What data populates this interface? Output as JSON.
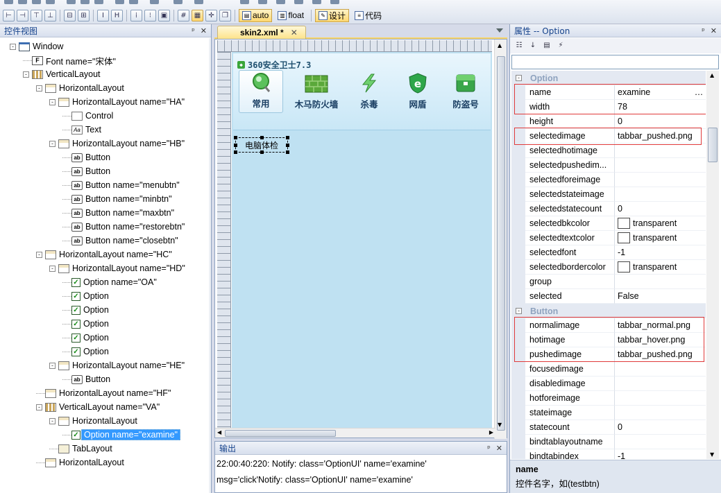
{
  "toolbar": {
    "auto_label": "auto",
    "float_label": "float",
    "design_label": "设计",
    "code_label": "代码"
  },
  "left_panel": {
    "title": "控件视图"
  },
  "tree": [
    {
      "label": "Window",
      "icon": "window-icon",
      "depth": 0,
      "expander": "-"
    },
    {
      "label": "Font name=\"宋体\"",
      "icon": "font-icon",
      "depth": 1
    },
    {
      "label": "VerticalLayout",
      "icon": "vertical-layout-icon",
      "depth": 1,
      "expander": "-"
    },
    {
      "label": "HorizontalLayout",
      "icon": "horizontal-layout-icon",
      "depth": 2,
      "expander": "-"
    },
    {
      "label": "HorizontalLayout name=\"HA\"",
      "icon": "horizontal-layout-icon",
      "depth": 3,
      "expander": "-"
    },
    {
      "label": "Control",
      "icon": "control-icon",
      "depth": 4
    },
    {
      "label": "Text",
      "icon": "text-icon",
      "depth": 4
    },
    {
      "label": "HorizontalLayout name=\"HB\"",
      "icon": "horizontal-layout-icon",
      "depth": 3,
      "expander": "-"
    },
    {
      "label": "Button",
      "icon": "button-icon",
      "depth": 4
    },
    {
      "label": "Button",
      "icon": "button-icon",
      "depth": 4
    },
    {
      "label": "Button name=\"menubtn\"",
      "icon": "button-icon",
      "depth": 4
    },
    {
      "label": "Button name=\"minbtn\"",
      "icon": "button-icon",
      "depth": 4
    },
    {
      "label": "Button name=\"maxbtn\"",
      "icon": "button-icon",
      "depth": 4
    },
    {
      "label": "Button name=\"restorebtn\"",
      "icon": "button-icon",
      "depth": 4
    },
    {
      "label": "Button name=\"closebtn\"",
      "icon": "button-icon",
      "depth": 4
    },
    {
      "label": "HorizontalLayout name=\"HC\"",
      "icon": "horizontal-layout-icon",
      "depth": 2,
      "expander": "-"
    },
    {
      "label": "HorizontalLayout name=\"HD\"",
      "icon": "horizontal-layout-icon",
      "depth": 3,
      "expander": "-"
    },
    {
      "label": "Option name=\"OA\"",
      "icon": "option-checkbox-icon",
      "depth": 4
    },
    {
      "label": "Option",
      "icon": "option-checkbox-icon",
      "depth": 4
    },
    {
      "label": "Option",
      "icon": "option-checkbox-icon",
      "depth": 4
    },
    {
      "label": "Option",
      "icon": "option-checkbox-icon",
      "depth": 4
    },
    {
      "label": "Option",
      "icon": "option-checkbox-icon",
      "depth": 4
    },
    {
      "label": "Option",
      "icon": "option-checkbox-icon",
      "depth": 4
    },
    {
      "label": "HorizontalLayout name=\"HE\"",
      "icon": "horizontal-layout-icon",
      "depth": 3,
      "expander": "-"
    },
    {
      "label": "Button",
      "icon": "button-icon",
      "depth": 4
    },
    {
      "label": "HorizontalLayout name=\"HF\"",
      "icon": "horizontal-layout-icon",
      "depth": 2
    },
    {
      "label": "VerticalLayout name=\"VA\"",
      "icon": "vertical-layout-icon",
      "depth": 2,
      "expander": "-"
    },
    {
      "label": "HorizontalLayout",
      "icon": "horizontal-layout-icon",
      "depth": 3,
      "expander": "-"
    },
    {
      "label": "Option name=\"examine\"",
      "icon": "option-checkbox-icon",
      "depth": 4,
      "selected": true
    },
    {
      "label": "TabLayout",
      "icon": "tab-layout-icon",
      "depth": 3
    },
    {
      "label": "HorizontalLayout",
      "icon": "horizontal-layout-icon",
      "depth": 2
    }
  ],
  "editor": {
    "tab_label": "skin2.xml *"
  },
  "preview": {
    "app_title": "360安全卫士7.3",
    "nav": [
      {
        "label": "常用",
        "icon": "magnifier-icon",
        "active": true
      },
      {
        "label": "木马防火墙",
        "icon": "firewall-icon"
      },
      {
        "label": "杀毒",
        "icon": "lightning-icon"
      },
      {
        "label": "网盾",
        "icon": "shield-e-icon"
      },
      {
        "label": "防盗号",
        "icon": "safe-box-icon"
      }
    ],
    "selected_control_label": "电脑体检"
  },
  "output": {
    "title": "输出",
    "lines": [
      "22:00:40:220: Notify: class='OptionUI' name='examine'",
      "msg='click'Notify: class='OptionUI' name='examine'"
    ]
  },
  "properties": {
    "title": "属性 -- Option",
    "categories": [
      {
        "name": "Option",
        "rows": [
          {
            "k": "name",
            "v": "examine",
            "ellipsis": true
          },
          {
            "k": "width",
            "v": "78"
          },
          {
            "k": "height",
            "v": "0"
          },
          {
            "k": "selectedimage",
            "v": "tabbar_pushed.png"
          },
          {
            "k": "selectedhotimage",
            "v": ""
          },
          {
            "k": "selectedpushedim...",
            "v": ""
          },
          {
            "k": "selectedforeimage",
            "v": ""
          },
          {
            "k": "selectedstateimage",
            "v": ""
          },
          {
            "k": "selectedstatecount",
            "v": "0"
          },
          {
            "k": "selectedbkcolor",
            "v": "transparent",
            "swatch": true
          },
          {
            "k": "selectedtextcolor",
            "v": "transparent",
            "swatch": true
          },
          {
            "k": "selectedfont",
            "v": "-1"
          },
          {
            "k": "selectedbordercolor",
            "v": "transparent",
            "swatch": true
          },
          {
            "k": "group",
            "v": ""
          },
          {
            "k": "selected",
            "v": "False"
          }
        ]
      },
      {
        "name": "Button",
        "rows": [
          {
            "k": "normalimage",
            "v": "tabbar_normal.png"
          },
          {
            "k": "hotimage",
            "v": "tabbar_hover.png"
          },
          {
            "k": "pushedimage",
            "v": "tabbar_pushed.png"
          },
          {
            "k": "focusedimage",
            "v": ""
          },
          {
            "k": "disabledimage",
            "v": ""
          },
          {
            "k": "hotforeimage",
            "v": ""
          },
          {
            "k": "stateimage",
            "v": ""
          },
          {
            "k": "statecount",
            "v": "0"
          },
          {
            "k": "bindtablayoutname",
            "v": ""
          },
          {
            "k": "bindtabindex",
            "v": "-1"
          }
        ]
      }
    ],
    "help_name": "name",
    "help_desc": "控件名字，如(testbtn)"
  }
}
